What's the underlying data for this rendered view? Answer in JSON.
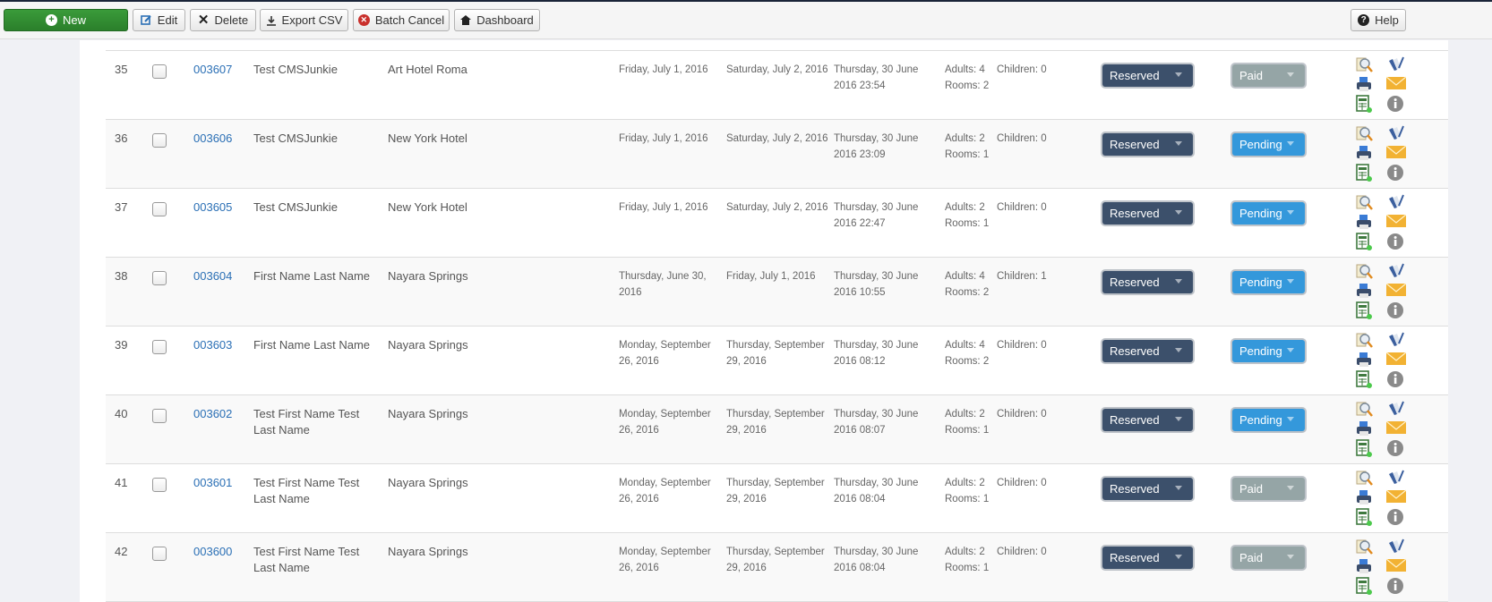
{
  "toolbar": {
    "buttons": [
      {
        "label": "New",
        "icon": "plus-circle-icon"
      },
      {
        "label": "Edit",
        "icon": "edit-icon"
      },
      {
        "label": "Delete",
        "icon": "x-icon"
      },
      {
        "label": "Export CSV",
        "icon": "download-icon"
      },
      {
        "label": "Batch Cancel",
        "icon": "cancel-circle-icon"
      },
      {
        "label": "Dashboard",
        "icon": "home-icon"
      }
    ],
    "help_label": "Help"
  },
  "colors": {
    "new_button": "#2e862e",
    "link": "#2a6fb5",
    "reserved_dropdown": "#3c506b",
    "paid_dropdown": "#95a5a6",
    "pending_dropdown": "#3498db",
    "mail_icon": "#f2b233"
  },
  "rows": [
    {
      "num": "35",
      "id": "003607",
      "name": "Test CMSJunkie",
      "hotel": "Art Hotel Roma",
      "checkin": "Friday, July 1, 2016",
      "checkout": "Saturday, July 2, 2016",
      "created": "Thursday, 30 June 2016 23:54",
      "adults": "Adults: 4",
      "children": "Children: 0",
      "rooms": "Rooms: 2",
      "status": "Reserved",
      "payment": "Paid"
    },
    {
      "num": "36",
      "id": "003606",
      "name": "Test CMSJunkie",
      "hotel": "New York Hotel",
      "checkin": "Friday, July 1, 2016",
      "checkout": "Saturday, July 2, 2016",
      "created": "Thursday, 30 June 2016 23:09",
      "adults": "Adults: 2",
      "children": "Children: 0",
      "rooms": "Rooms: 1",
      "status": "Reserved",
      "payment": "Pending"
    },
    {
      "num": "37",
      "id": "003605",
      "name": "Test CMSJunkie",
      "hotel": "New York Hotel",
      "checkin": "Friday, July 1, 2016",
      "checkout": "Saturday, July 2, 2016",
      "created": "Thursday, 30 June 2016 22:47",
      "adults": "Adults: 2",
      "children": "Children: 0",
      "rooms": "Rooms: 1",
      "status": "Reserved",
      "payment": "Pending"
    },
    {
      "num": "38",
      "id": "003604",
      "name": "First Name Last Name",
      "hotel": "Nayara Springs",
      "checkin": "Thursday, June 30, 2016",
      "checkout": "Friday, July 1, 2016",
      "created": "Thursday, 30 June 2016 10:55",
      "adults": "Adults: 4",
      "children": "Children: 1",
      "rooms": "Rooms: 2",
      "status": "Reserved",
      "payment": "Pending"
    },
    {
      "num": "39",
      "id": "003603",
      "name": "First Name Last Name",
      "hotel": "Nayara Springs",
      "checkin": "Monday, September 26, 2016",
      "checkout": "Thursday, September 29, 2016",
      "created": "Thursday, 30 June 2016 08:12",
      "adults": "Adults: 4",
      "children": "Children: 0",
      "rooms": "Rooms: 2",
      "status": "Reserved",
      "payment": "Pending"
    },
    {
      "num": "40",
      "id": "003602",
      "name": "Test First Name Test Last Name",
      "hotel": "Nayara Springs",
      "checkin": "Monday, September 26, 2016",
      "checkout": "Thursday, September 29, 2016",
      "created": "Thursday, 30 June 2016 08:07",
      "adults": "Adults: 2",
      "children": "Children: 0",
      "rooms": "Rooms: 1",
      "status": "Reserved",
      "payment": "Pending"
    },
    {
      "num": "41",
      "id": "003601",
      "name": "Test First Name Test Last Name",
      "hotel": "Nayara Springs",
      "checkin": "Monday, September 26, 2016",
      "checkout": "Thursday, September 29, 2016",
      "created": "Thursday, 30 June 2016 08:04",
      "adults": "Adults: 2",
      "children": "Children: 0",
      "rooms": "Rooms: 1",
      "status": "Reserved",
      "payment": "Paid"
    },
    {
      "num": "42",
      "id": "003600",
      "name": "Test First Name Test Last Name",
      "hotel": "Nayara Springs",
      "checkin": "Monday, September 26, 2016",
      "checkout": "Thursday, September 29, 2016",
      "created": "Thursday, 30 June 2016 08:04",
      "adults": "Adults: 2",
      "children": "Children: 0",
      "rooms": "Rooms: 1",
      "status": "Reserved",
      "payment": "Paid"
    }
  ],
  "row_action_icons": [
    "view-details-icon",
    "edit-document-icon",
    "print-icon",
    "email-icon",
    "invoice-icon",
    "info-icon"
  ]
}
